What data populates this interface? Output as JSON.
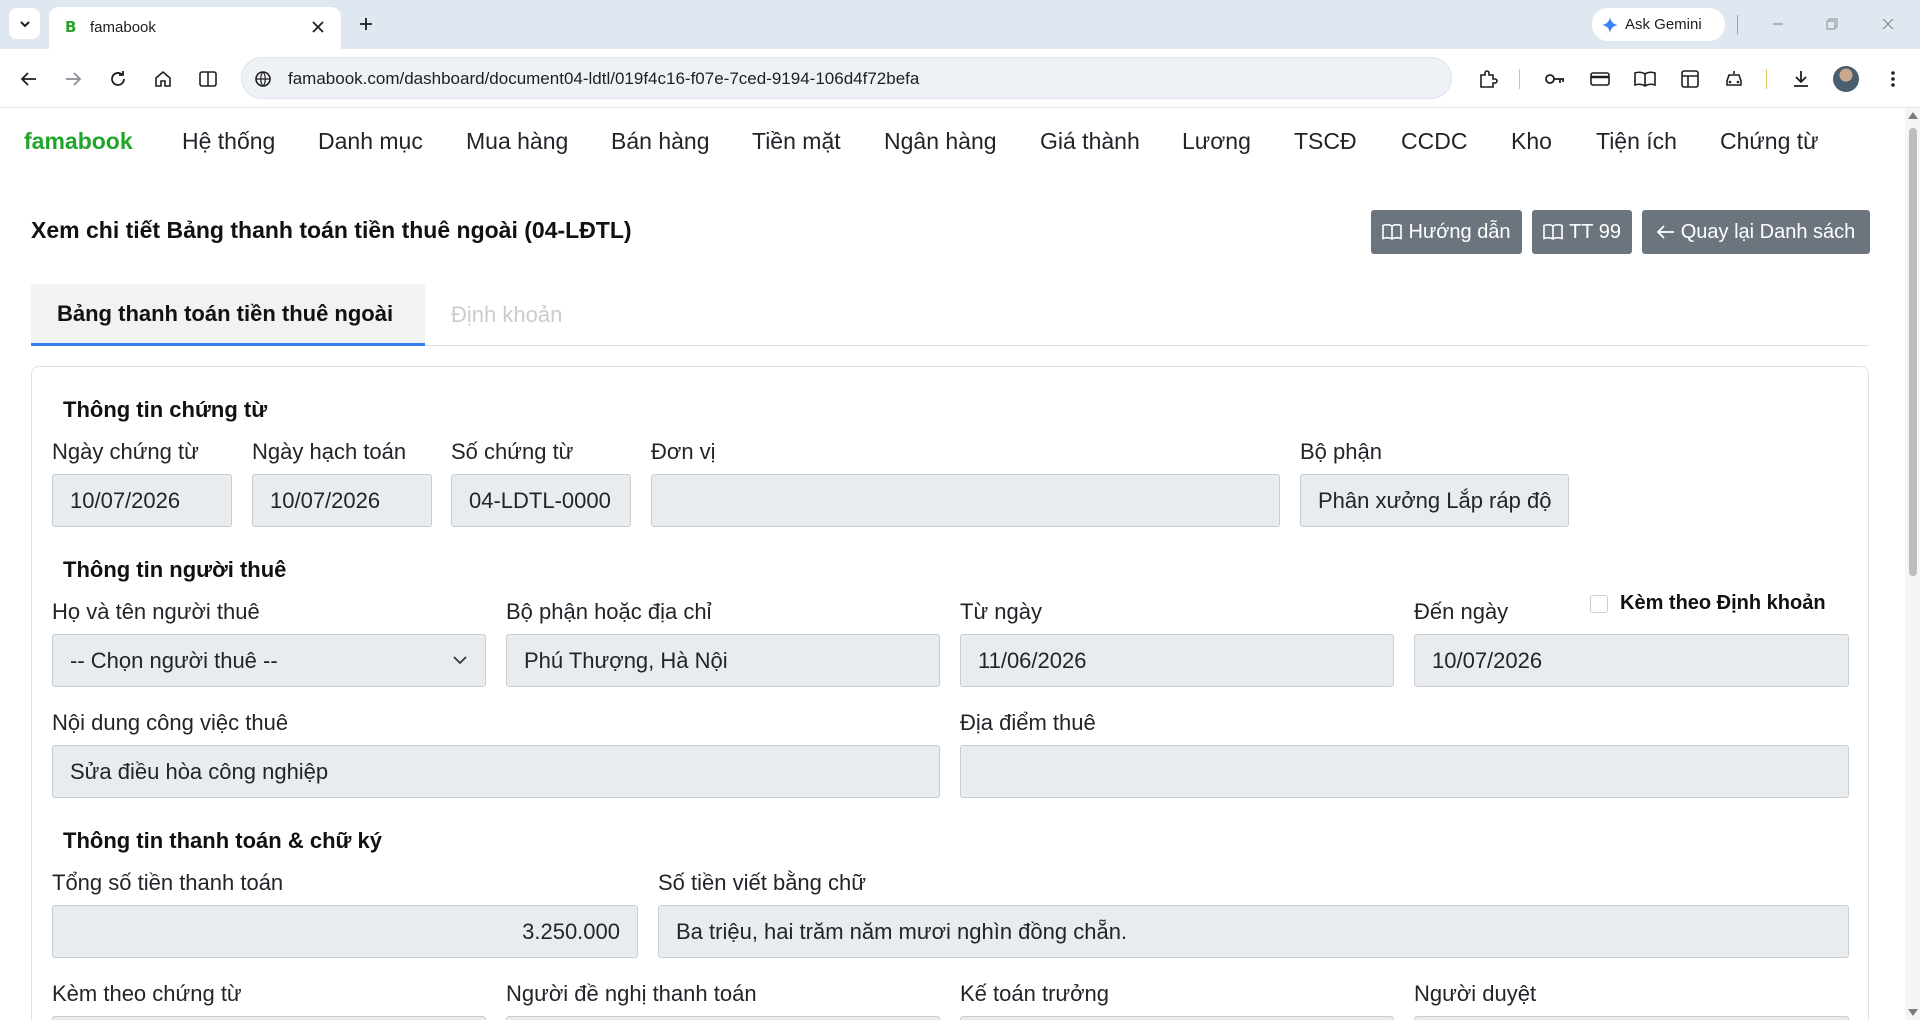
{
  "browser": {
    "tab_title": "famabook",
    "tab_favicon": "B",
    "url": "famabook.com/dashboard/document04-ldtl/019f4c16-f07e-7ced-9194-106d4f72befa",
    "gemini_label": "Ask Gemini"
  },
  "nav": {
    "brand": "famabook",
    "menu": [
      "Hệ thống",
      "Danh mục",
      "Mua hàng",
      "Bán hàng",
      "Tiền mặt",
      "Ngân hàng",
      "Giá thành",
      "Lương",
      "TSCĐ",
      "CCDC",
      "Kho",
      "Tiện ích",
      "Chứng từ"
    ]
  },
  "header": {
    "title": "Xem chi tiết Bảng thanh toán tiền thuê ngoài (04-LĐTL)",
    "btn_guide": "Hướng dẫn",
    "btn_tt99": "TT 99",
    "btn_back": "Quay lại Danh sách"
  },
  "tabs": {
    "main": "Bảng thanh toán tiền thuê ngoài",
    "entries": "Định khoản"
  },
  "doc_info": {
    "section": "Thông tin chứng từ",
    "date_label": "Ngày chứng từ",
    "date_value": "10/07/2026",
    "post_date_label": "Ngày hạch toán",
    "post_date_value": "10/07/2026",
    "number_label": "Số chứng từ",
    "number_value": "04-LDTL-0000",
    "unit_label": "Đơn vị",
    "unit_value": "",
    "dept_label": "Bộ phận",
    "dept_value": "Phân xưởng Lắp ráp độ",
    "attach_entries_label": "Kèm theo Định khoản"
  },
  "renter_info": {
    "section": "Thông tin người thuê",
    "name_label": "Họ và tên người thuê",
    "name_value": "-- Chọn người thuê --",
    "address_label": "Bộ phận hoặc địa chỉ",
    "address_value": "Phú Thượng, Hà Nội",
    "from_label": "Từ ngày",
    "from_value": "11/06/2026",
    "to_label": "Đến ngày",
    "to_value": "10/07/2026",
    "work_label": "Nội dung công việc thuê",
    "work_value": "Sửa điều hòa công nghiệp",
    "place_label": "Địa điểm thuê",
    "place_value": ""
  },
  "payment": {
    "section": "Thông tin thanh toán & chữ ký",
    "total_label": "Tổng số tiền thanh toán",
    "total_value": "3.250.000",
    "words_label": "Số tiền viết bằng chữ",
    "words_value": "Ba triệu, hai trăm năm mươi nghìn đồng chẵn.",
    "attached_label": "Kèm theo chứng từ",
    "proposer_label": "Người đề nghị thanh toán",
    "chief_accountant_label": "Kế toán trưởng",
    "approver_label": "Người duyệt"
  }
}
